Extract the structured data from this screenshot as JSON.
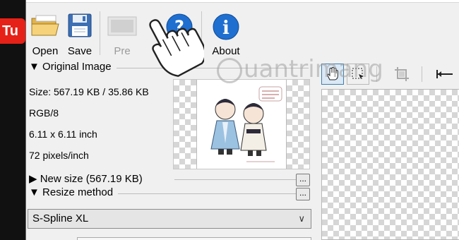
{
  "desktop": {
    "logo_text": "Tu"
  },
  "toolbar": {
    "open_label": "Open",
    "save_label": "Save",
    "preview_label": "Pre",
    "help_label": "Help",
    "about_label": "About"
  },
  "original_image": {
    "header": "Original Image",
    "size": "Size: 567.19 KB / 35.86 KB",
    "mode": "RGB/8",
    "dimensions": "6.11 x 6.11 inch",
    "resolution": "72 pixels/inch"
  },
  "new_size": {
    "header": "New size (567.19 KB)",
    "more_label": "..."
  },
  "resize_method": {
    "header": "Resize method",
    "more_label": "...",
    "selected": "S-Spline XL"
  },
  "watermark": {
    "text": "uantrimang"
  },
  "icons": {
    "open": "folder-icon",
    "save": "floppy-icon",
    "preview": "preview-icon",
    "help": "help-icon",
    "about": "info-icon",
    "hand": "hand-tool-icon",
    "crop_select": "crop-select-icon",
    "crop": "crop-icon",
    "fit_width": "fit-width-icon",
    "pointer": "hand-cursor-icon"
  },
  "colors": {
    "help_blue": "#1e6fd0",
    "youtube_red": "#e62117"
  }
}
